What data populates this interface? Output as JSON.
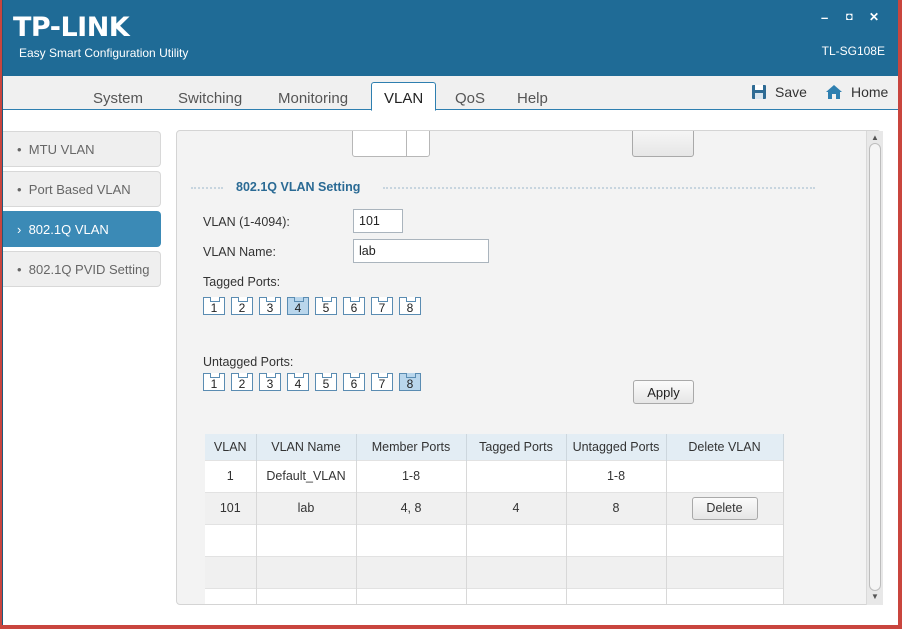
{
  "window": {
    "logo": "TP-LINK",
    "subtitle": "Easy Smart Configuration Utility",
    "model": "TL-SG108E",
    "controls": {
      "minimize": "–",
      "maximize": "◘",
      "close": "✕"
    }
  },
  "tabs": [
    {
      "label": "System",
      "active": false
    },
    {
      "label": "Switching",
      "active": false
    },
    {
      "label": "Monitoring",
      "active": false
    },
    {
      "label": "VLAN",
      "active": true
    },
    {
      "label": "QoS",
      "active": false
    },
    {
      "label": "Help",
      "active": false
    }
  ],
  "toolbar": {
    "save_label": "Save",
    "save_icon": "floppy-disk-icon",
    "home_label": "Home",
    "home_icon": "home-icon"
  },
  "sidebar": {
    "items": [
      {
        "label": "MTU VLAN",
        "bullet": "•",
        "active": false
      },
      {
        "label": "Port Based VLAN",
        "bullet": "•",
        "active": false
      },
      {
        "label": "802.1Q VLAN",
        "bullet": "›",
        "active": true
      },
      {
        "label": "802.1Q PVID Setting",
        "bullet": "•",
        "active": false
      }
    ]
  },
  "section": {
    "title": "802.1Q VLAN Setting"
  },
  "form": {
    "vlan_id_label": "VLAN (1-4094):",
    "vlan_id_value": "101",
    "vlan_name_label": "VLAN Name:",
    "vlan_name_value": "lab",
    "tagged_label": "Tagged Ports:",
    "untagged_label": "Untagged Ports:",
    "apply_label": "Apply"
  },
  "ports": {
    "labels": [
      "1",
      "2",
      "3",
      "4",
      "5",
      "6",
      "7",
      "8"
    ],
    "tagged_selected": [
      "4"
    ],
    "untagged_selected": [
      "8"
    ]
  },
  "table": {
    "headers": [
      "VLAN",
      "VLAN Name",
      "Member Ports",
      "Tagged Ports",
      "Untagged Ports",
      "Delete VLAN"
    ],
    "rows": [
      [
        "1",
        "Default_VLAN",
        "1-8",
        "",
        "1-8",
        ""
      ],
      [
        "101",
        "lab",
        "4, 8",
        "4",
        "8",
        "Delete"
      ],
      [
        "",
        "",
        "",
        "",
        "",
        ""
      ],
      [
        "",
        "",
        "",
        "",
        "",
        ""
      ],
      [
        "",
        "",
        "",
        "",
        "",
        ""
      ]
    ]
  },
  "colors": {
    "titlebar": "#1f6b96",
    "accent": "#3b8ab6",
    "section_title": "#2a6a94"
  }
}
